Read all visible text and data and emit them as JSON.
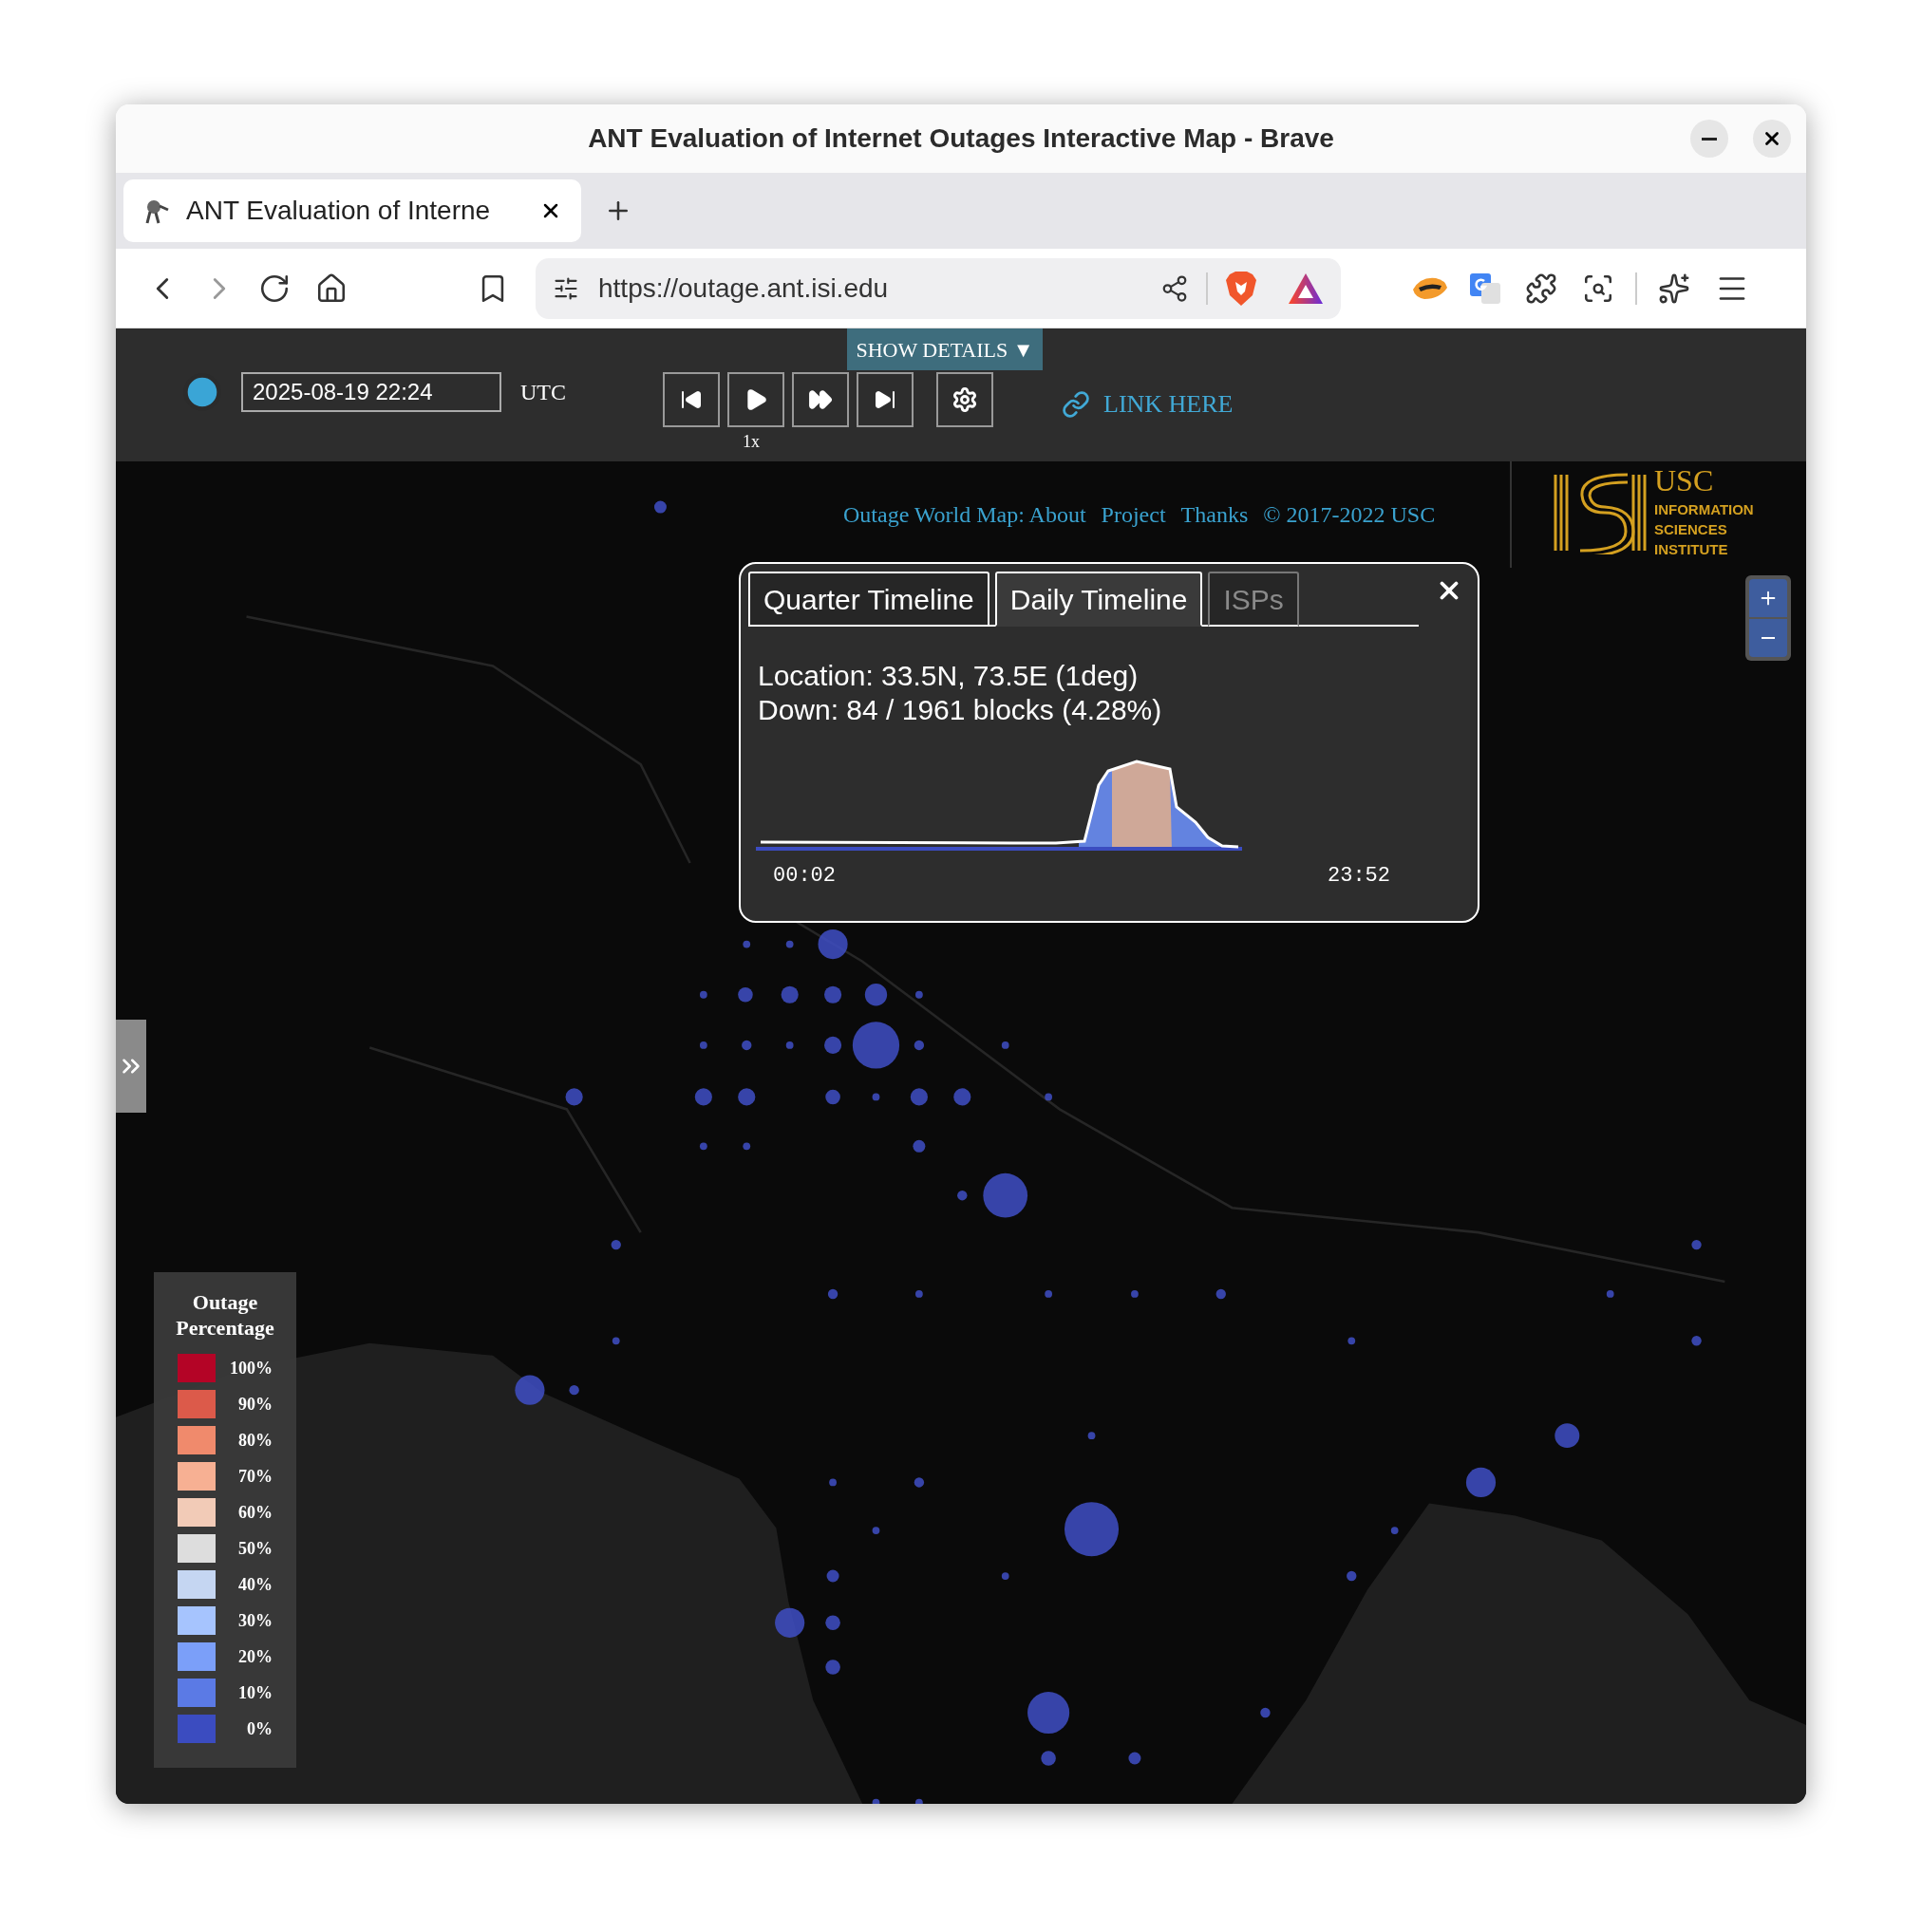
{
  "window": {
    "title": "ANT Evaluation of Internet Outages Interactive Map - Brave"
  },
  "browser_tabs": [
    {
      "title": "ANT Evaluation of Interne",
      "selected": true
    }
  ],
  "address_bar": {
    "url": "https://outage.ant.isi.edu"
  },
  "controls": {
    "show_details": "SHOW DETAILS ▼",
    "date_time": "2025-08-19 22:24",
    "timezone": "UTC",
    "playing": false,
    "speed": "1x",
    "link": "LINK HERE"
  },
  "footer_links": [
    "Outage World Map: About",
    "Project",
    "Thanks",
    "© 2017-2022 USC"
  ],
  "logo": {
    "lines": [
      "USC",
      "INFORMATION",
      "SCIENCES",
      "INSTITUTE"
    ]
  },
  "popup": {
    "tabs": [
      {
        "label": "Quarter Timeline",
        "selected": false,
        "disabled": false
      },
      {
        "label": "Daily Timeline",
        "selected": true,
        "disabled": false
      },
      {
        "label": "ISPs",
        "selected": false,
        "disabled": true
      }
    ],
    "lines": [
      "Location: 33.5N, 73.5E (1deg)",
      "Down: 84 / 1961 blocks (4.28%)"
    ],
    "time_start": "00:02",
    "time_end": "23:52"
  },
  "legend": {
    "title": "Outage Percentage",
    "items": [
      {
        "label": "100%",
        "color": "#b40426"
      },
      {
        "label": "90%",
        "color": "#dc5a4a"
      },
      {
        "label": "80%",
        "color": "#f08a6c"
      },
      {
        "label": "70%",
        "color": "#f7b093"
      },
      {
        "label": "60%",
        "color": "#f2cbb7"
      },
      {
        "label": "50%",
        "color": "#dddddd"
      },
      {
        "label": "40%",
        "color": "#c5d6f2"
      },
      {
        "label": "30%",
        "color": "#a6c4fe"
      },
      {
        "label": "20%",
        "color": "#7b9ff9"
      },
      {
        "label": "10%",
        "color": "#5b7ae5"
      },
      {
        "label": "0%",
        "color": "#3b4cc0"
      }
    ]
  }
}
